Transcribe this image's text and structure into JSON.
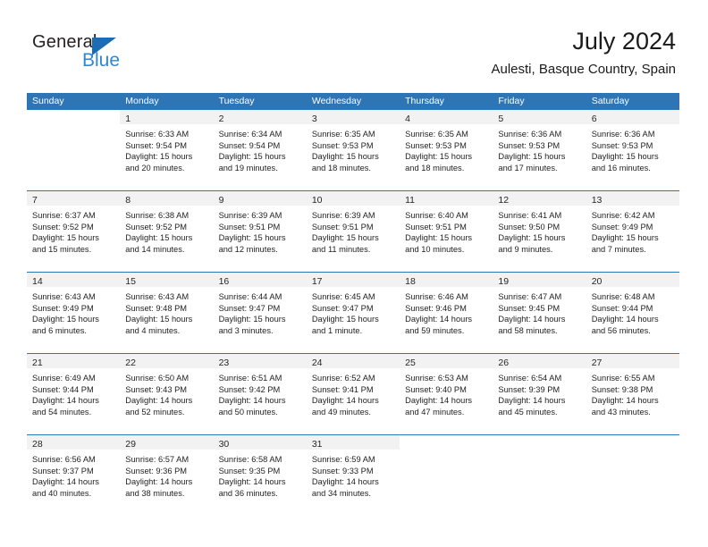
{
  "brand": {
    "name_part1": "General",
    "name_part2": "Blue",
    "triangle_color": "#1b6cb5",
    "blue_text_color": "#2e86d6"
  },
  "header": {
    "title": "July 2024",
    "subtitle": "Aulesti, Basque Country, Spain"
  },
  "theme": {
    "header_blue": "#2E75B6",
    "day_band_gray": "#F2F2F2"
  },
  "weekdays": [
    "Sunday",
    "Monday",
    "Tuesday",
    "Wednesday",
    "Thursday",
    "Friday",
    "Saturday"
  ],
  "weeks": [
    {
      "days": [
        {
          "num": "",
          "lines": [],
          "blank": true
        },
        {
          "num": "1",
          "lines": [
            "Sunrise: 6:33 AM",
            "Sunset: 9:54 PM",
            "Daylight: 15 hours",
            "and 20 minutes."
          ]
        },
        {
          "num": "2",
          "lines": [
            "Sunrise: 6:34 AM",
            "Sunset: 9:54 PM",
            "Daylight: 15 hours",
            "and 19 minutes."
          ]
        },
        {
          "num": "3",
          "lines": [
            "Sunrise: 6:35 AM",
            "Sunset: 9:53 PM",
            "Daylight: 15 hours",
            "and 18 minutes."
          ]
        },
        {
          "num": "4",
          "lines": [
            "Sunrise: 6:35 AM",
            "Sunset: 9:53 PM",
            "Daylight: 15 hours",
            "and 18 minutes."
          ]
        },
        {
          "num": "5",
          "lines": [
            "Sunrise: 6:36 AM",
            "Sunset: 9:53 PM",
            "Daylight: 15 hours",
            "and 17 minutes."
          ]
        },
        {
          "num": "6",
          "lines": [
            "Sunrise: 6:36 AM",
            "Sunset: 9:53 PM",
            "Daylight: 15 hours",
            "and 16 minutes."
          ]
        }
      ]
    },
    {
      "days": [
        {
          "num": "7",
          "lines": [
            "Sunrise: 6:37 AM",
            "Sunset: 9:52 PM",
            "Daylight: 15 hours",
            "and 15 minutes."
          ]
        },
        {
          "num": "8",
          "lines": [
            "Sunrise: 6:38 AM",
            "Sunset: 9:52 PM",
            "Daylight: 15 hours",
            "and 14 minutes."
          ]
        },
        {
          "num": "9",
          "lines": [
            "Sunrise: 6:39 AM",
            "Sunset: 9:51 PM",
            "Daylight: 15 hours",
            "and 12 minutes."
          ]
        },
        {
          "num": "10",
          "lines": [
            "Sunrise: 6:39 AM",
            "Sunset: 9:51 PM",
            "Daylight: 15 hours",
            "and 11 minutes."
          ]
        },
        {
          "num": "11",
          "lines": [
            "Sunrise: 6:40 AM",
            "Sunset: 9:51 PM",
            "Daylight: 15 hours",
            "and 10 minutes."
          ]
        },
        {
          "num": "12",
          "lines": [
            "Sunrise: 6:41 AM",
            "Sunset: 9:50 PM",
            "Daylight: 15 hours",
            "and 9 minutes."
          ]
        },
        {
          "num": "13",
          "lines": [
            "Sunrise: 6:42 AM",
            "Sunset: 9:49 PM",
            "Daylight: 15 hours",
            "and 7 minutes."
          ]
        }
      ]
    },
    {
      "days": [
        {
          "num": "14",
          "lines": [
            "Sunrise: 6:43 AM",
            "Sunset: 9:49 PM",
            "Daylight: 15 hours",
            "and 6 minutes."
          ]
        },
        {
          "num": "15",
          "lines": [
            "Sunrise: 6:43 AM",
            "Sunset: 9:48 PM",
            "Daylight: 15 hours",
            "and 4 minutes."
          ]
        },
        {
          "num": "16",
          "lines": [
            "Sunrise: 6:44 AM",
            "Sunset: 9:47 PM",
            "Daylight: 15 hours",
            "and 3 minutes."
          ]
        },
        {
          "num": "17",
          "lines": [
            "Sunrise: 6:45 AM",
            "Sunset: 9:47 PM",
            "Daylight: 15 hours",
            "and 1 minute."
          ]
        },
        {
          "num": "18",
          "lines": [
            "Sunrise: 6:46 AM",
            "Sunset: 9:46 PM",
            "Daylight: 14 hours",
            "and 59 minutes."
          ]
        },
        {
          "num": "19",
          "lines": [
            "Sunrise: 6:47 AM",
            "Sunset: 9:45 PM",
            "Daylight: 14 hours",
            "and 58 minutes."
          ]
        },
        {
          "num": "20",
          "lines": [
            "Sunrise: 6:48 AM",
            "Sunset: 9:44 PM",
            "Daylight: 14 hours",
            "and 56 minutes."
          ]
        }
      ]
    },
    {
      "days": [
        {
          "num": "21",
          "lines": [
            "Sunrise: 6:49 AM",
            "Sunset: 9:44 PM",
            "Daylight: 14 hours",
            "and 54 minutes."
          ]
        },
        {
          "num": "22",
          "lines": [
            "Sunrise: 6:50 AM",
            "Sunset: 9:43 PM",
            "Daylight: 14 hours",
            "and 52 minutes."
          ]
        },
        {
          "num": "23",
          "lines": [
            "Sunrise: 6:51 AM",
            "Sunset: 9:42 PM",
            "Daylight: 14 hours",
            "and 50 minutes."
          ]
        },
        {
          "num": "24",
          "lines": [
            "Sunrise: 6:52 AM",
            "Sunset: 9:41 PM",
            "Daylight: 14 hours",
            "and 49 minutes."
          ]
        },
        {
          "num": "25",
          "lines": [
            "Sunrise: 6:53 AM",
            "Sunset: 9:40 PM",
            "Daylight: 14 hours",
            "and 47 minutes."
          ]
        },
        {
          "num": "26",
          "lines": [
            "Sunrise: 6:54 AM",
            "Sunset: 9:39 PM",
            "Daylight: 14 hours",
            "and 45 minutes."
          ]
        },
        {
          "num": "27",
          "lines": [
            "Sunrise: 6:55 AM",
            "Sunset: 9:38 PM",
            "Daylight: 14 hours",
            "and 43 minutes."
          ]
        }
      ]
    },
    {
      "days": [
        {
          "num": "28",
          "lines": [
            "Sunrise: 6:56 AM",
            "Sunset: 9:37 PM",
            "Daylight: 14 hours",
            "and 40 minutes."
          ]
        },
        {
          "num": "29",
          "lines": [
            "Sunrise: 6:57 AM",
            "Sunset: 9:36 PM",
            "Daylight: 14 hours",
            "and 38 minutes."
          ]
        },
        {
          "num": "30",
          "lines": [
            "Sunrise: 6:58 AM",
            "Sunset: 9:35 PM",
            "Daylight: 14 hours",
            "and 36 minutes."
          ]
        },
        {
          "num": "31",
          "lines": [
            "Sunrise: 6:59 AM",
            "Sunset: 9:33 PM",
            "Daylight: 14 hours",
            "and 34 minutes."
          ]
        },
        {
          "num": "",
          "lines": [],
          "blank": true
        },
        {
          "num": "",
          "lines": [],
          "blank": true
        },
        {
          "num": "",
          "lines": [],
          "blank": true
        }
      ]
    }
  ]
}
